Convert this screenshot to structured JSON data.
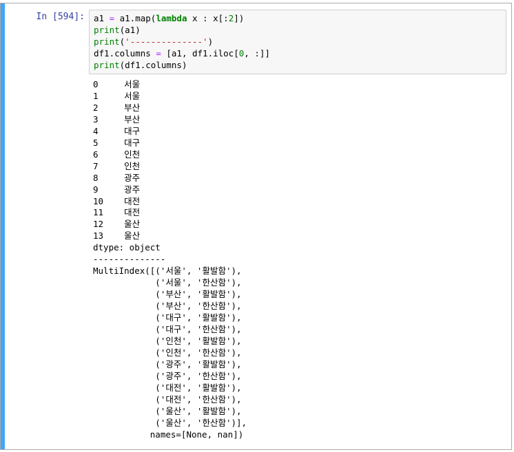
{
  "cell": {
    "prompt": "In [594]:",
    "code_lines": [
      [
        {
          "cls": "tok-plain",
          "text": "a1 "
        },
        {
          "cls": "tok-op",
          "text": "="
        },
        {
          "cls": "tok-plain",
          "text": " a1.map("
        },
        {
          "cls": "tok-keyword",
          "text": "lambda"
        },
        {
          "cls": "tok-plain",
          "text": " x : x[:"
        },
        {
          "cls": "tok-number",
          "text": "2"
        },
        {
          "cls": "tok-plain",
          "text": "])"
        }
      ],
      [
        {
          "cls": "tok-builtin",
          "text": "print"
        },
        {
          "cls": "tok-plain",
          "text": "(a1)"
        }
      ],
      [
        {
          "cls": "tok-builtin",
          "text": "print"
        },
        {
          "cls": "tok-plain",
          "text": "("
        },
        {
          "cls": "tok-string",
          "text": "'--------------'"
        },
        {
          "cls": "tok-plain",
          "text": ")"
        }
      ],
      [
        {
          "cls": "tok-plain",
          "text": "df1.columns "
        },
        {
          "cls": "tok-op",
          "text": "="
        },
        {
          "cls": "tok-plain",
          "text": " [a1, df1.iloc["
        },
        {
          "cls": "tok-number",
          "text": "0"
        },
        {
          "cls": "tok-plain",
          "text": ", :]]"
        }
      ],
      [
        {
          "cls": "tok-builtin",
          "text": "print"
        },
        {
          "cls": "tok-plain",
          "text": "(df1.columns)"
        }
      ]
    ],
    "output_lines": [
      "0     서울",
      "1     서울",
      "2     부산",
      "3     부산",
      "4     대구",
      "5     대구",
      "6     인천",
      "7     인천",
      "8     광주",
      "9     광주",
      "10    대전",
      "11    대전",
      "12    울산",
      "13    울산",
      "dtype: object",
      "--------------",
      "MultiIndex([('서울', '활발함'),",
      "            ('서울', '한산함'),",
      "            ('부산', '활발함'),",
      "            ('부산', '한산함'),",
      "            ('대구', '활발함'),",
      "            ('대구', '한산함'),",
      "            ('인천', '활발함'),",
      "            ('인천', '한산함'),",
      "            ('광주', '활발함'),",
      "            ('광주', '한산함'),",
      "            ('대전', '활발함'),",
      "            ('대전', '한산함'),",
      "            ('울산', '활발함'),",
      "            ('울산', '한산함')],",
      "           names=[None, nan])"
    ]
  },
  "colors": {
    "selected_bar": "#42a5f5",
    "prompt": "#303f9f",
    "input_background": "#f7f7f7"
  }
}
